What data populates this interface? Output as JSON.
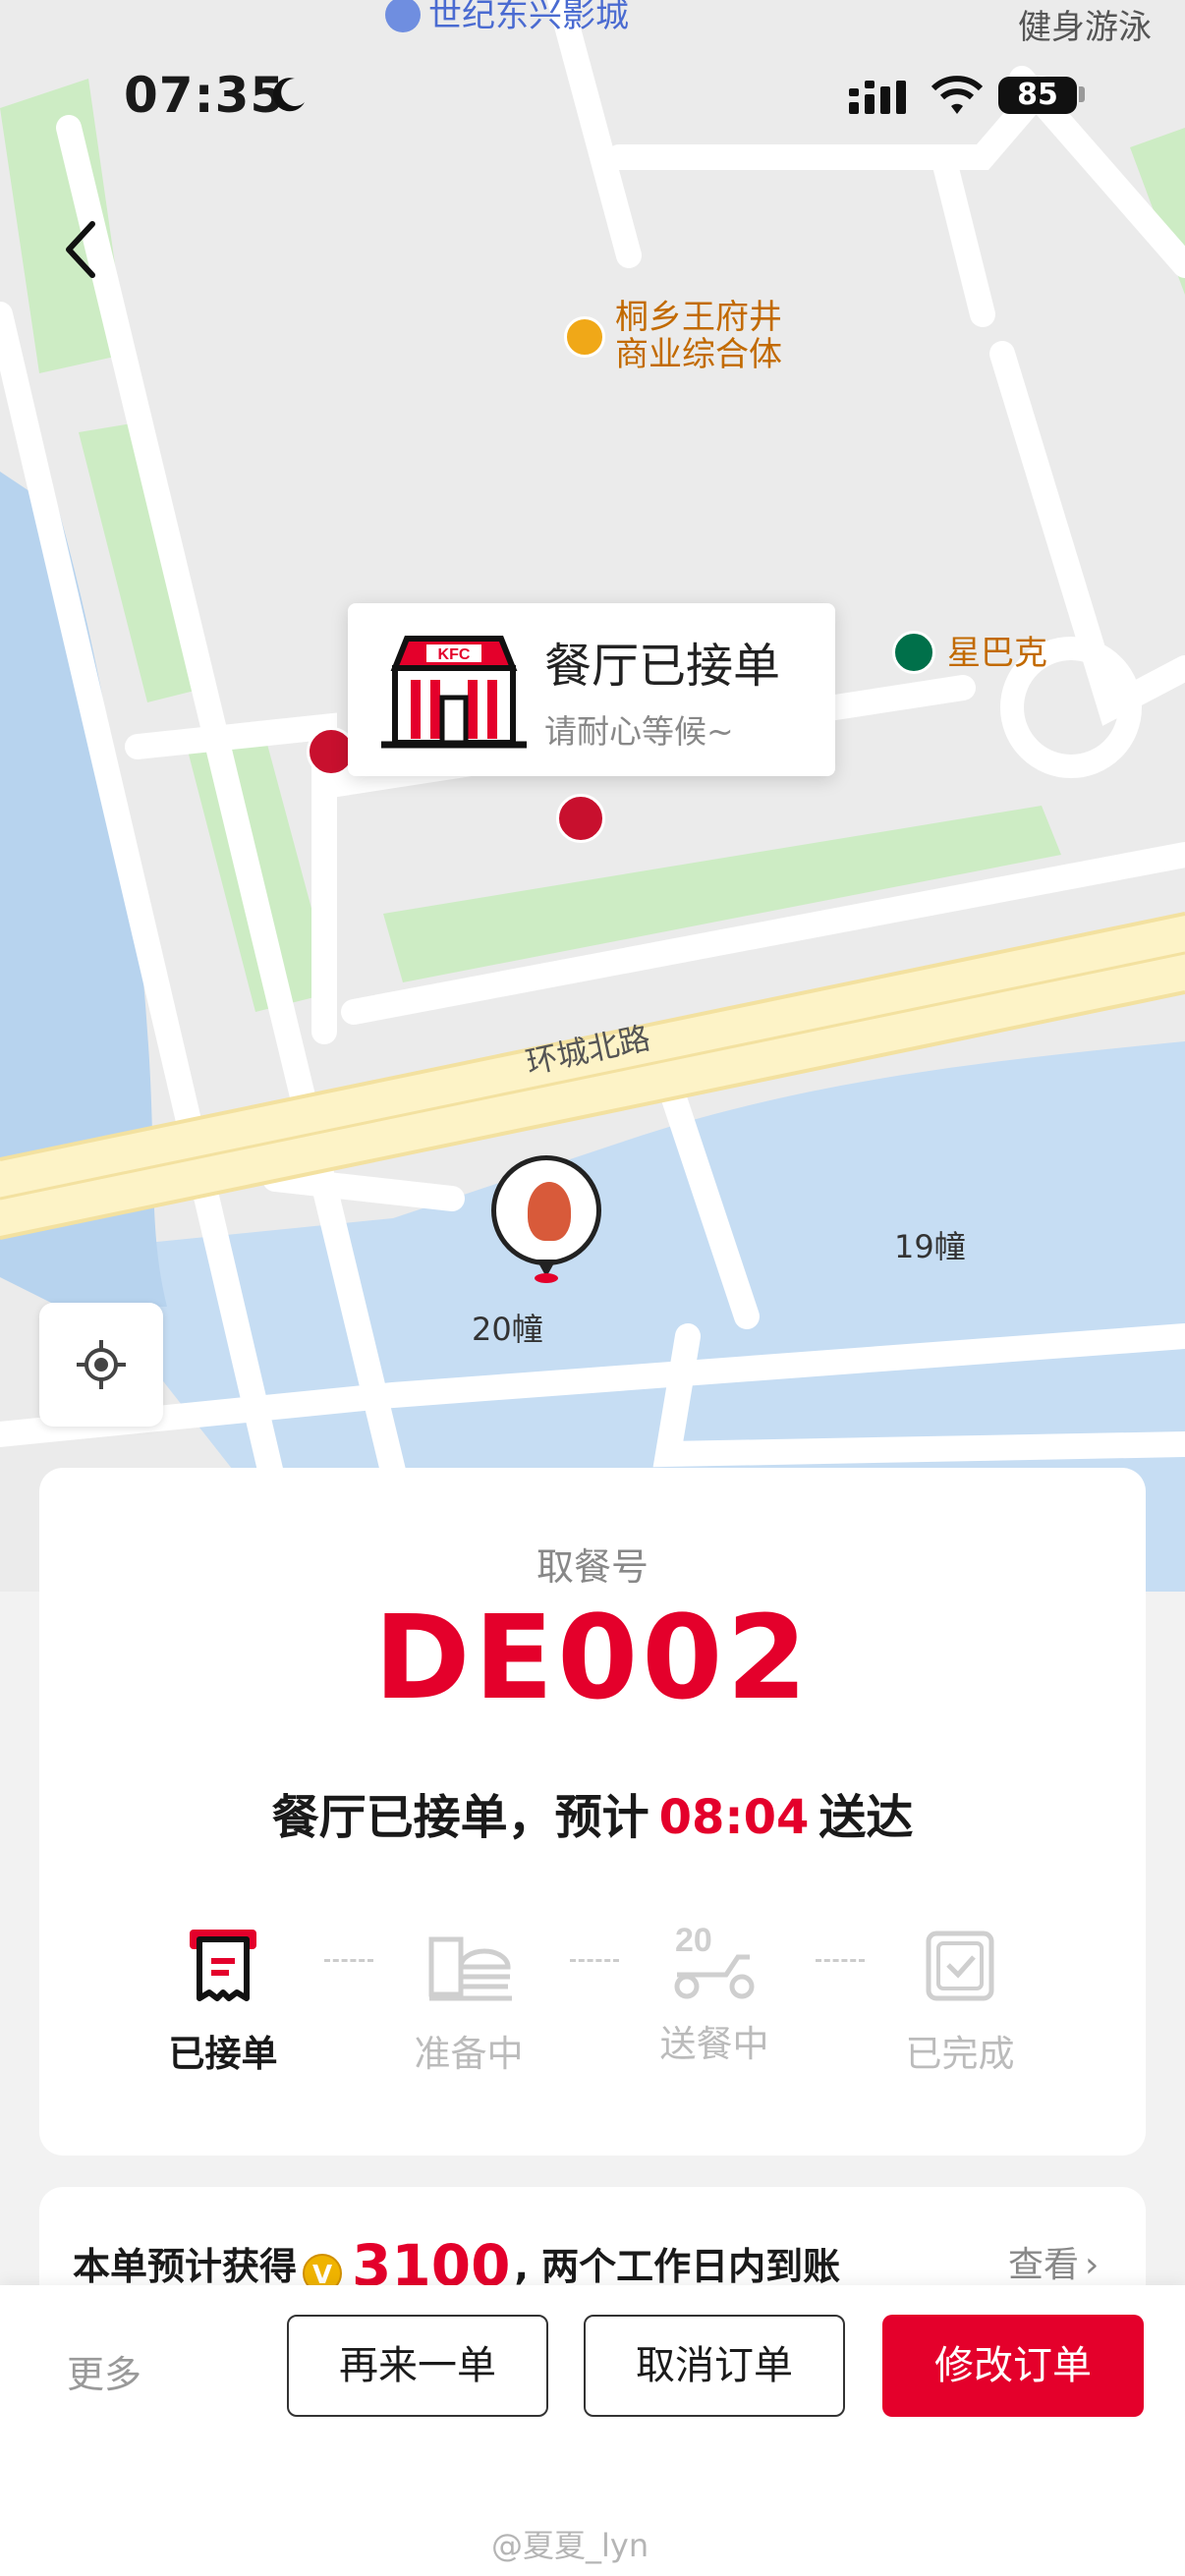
{
  "status_bar": {
    "time": "07:35",
    "battery": "85"
  },
  "map": {
    "top_poi_partial": "世纪东兴影城",
    "top_right_poi": "健身游泳",
    "mall_poi": [
      "桐乡王府井",
      "商业综合体"
    ],
    "starbucks": "星巴克",
    "road": "环城北路",
    "building_20": "20幢",
    "building_19": "19幢",
    "colors": {
      "road": "#fdf3c7",
      "water": "#c6ddf3",
      "green": "#cdecc4",
      "land": "#ebebeb"
    }
  },
  "popup": {
    "title": "餐厅已接单",
    "subtitle": "请耐心等候~"
  },
  "order": {
    "pickup_label": "取餐号",
    "pickup_code": "DE002",
    "eta_prefix": "餐厅已接单，预计",
    "eta_time": "08:04",
    "eta_suffix": "送达",
    "steps": [
      {
        "label": "已接单",
        "icon": "receipt-icon",
        "active": true
      },
      {
        "label": "准备中",
        "icon": "burger-icon",
        "active": false
      },
      {
        "label": "送餐中",
        "icon": "scooter-icon",
        "active": false
      },
      {
        "label": "已完成",
        "icon": "check-box-icon",
        "active": false
      }
    ]
  },
  "points": {
    "prefix": "本单预计获得",
    "value": "3100",
    "suffix": ", 两个工作日内到账",
    "view_label": "查看",
    "coin_letter": "V"
  },
  "actions": {
    "more": "更多",
    "reorder": "再来一单",
    "cancel": "取消订单",
    "modify": "修改订单"
  },
  "watermark": "@夏夏_lyn",
  "colors": {
    "accent": "#e4002b"
  }
}
